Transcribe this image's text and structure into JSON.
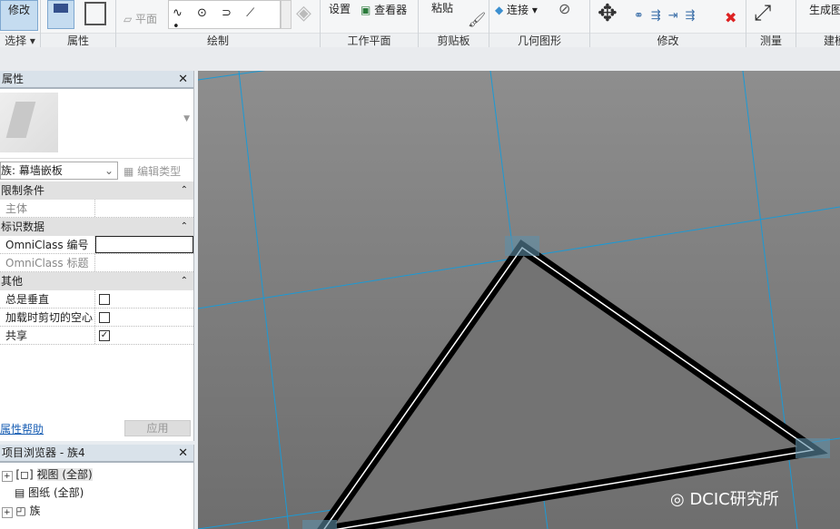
{
  "ribbon": {
    "groups": [
      {
        "label": "选择 ▾",
        "tools": [
          "修改"
        ]
      },
      {
        "label": "属性",
        "tools": []
      },
      {
        "label": "绘制",
        "tools": [
          "平面"
        ]
      },
      {
        "label": "工作平面",
        "tools": [
          "设置",
          "查看器"
        ]
      },
      {
        "label": "剪贴板",
        "tools": [
          "粘贴"
        ]
      },
      {
        "label": "几何图形",
        "tools": [
          "连接"
        ]
      },
      {
        "label": "修改",
        "tools": []
      },
      {
        "label": "测量",
        "tools": []
      },
      {
        "label": "建模",
        "tools": [
          "生成图"
        ]
      }
    ]
  },
  "properties": {
    "title": "属性",
    "family_select": "族: 幕墙嵌板",
    "edit_type": "编辑类型",
    "sections": [
      {
        "name": "限制条件",
        "rows": [
          {
            "key": "主体",
            "value": ""
          }
        ]
      },
      {
        "name": "标识数据",
        "rows": [
          {
            "key": "OmniClass 编号",
            "value": ""
          },
          {
            "key": "OmniClass 标题",
            "value": ""
          }
        ]
      },
      {
        "name": "其他",
        "rows": [
          {
            "key": "总是垂直",
            "checked": false
          },
          {
            "key": "加载时剪切的空心",
            "checked": false
          },
          {
            "key": "共享",
            "checked": true
          }
        ]
      }
    ],
    "help_link": "属性帮助",
    "apply": "应用",
    "check": "✓"
  },
  "browser": {
    "title": "项目浏览器 - 族4",
    "items": [
      "视图 (全部)",
      "图纸 (全部)",
      "族"
    ]
  },
  "watermark": "DCIC研究所",
  "colors": {
    "grid": "#1a9ad6",
    "canvas": "#808080"
  }
}
